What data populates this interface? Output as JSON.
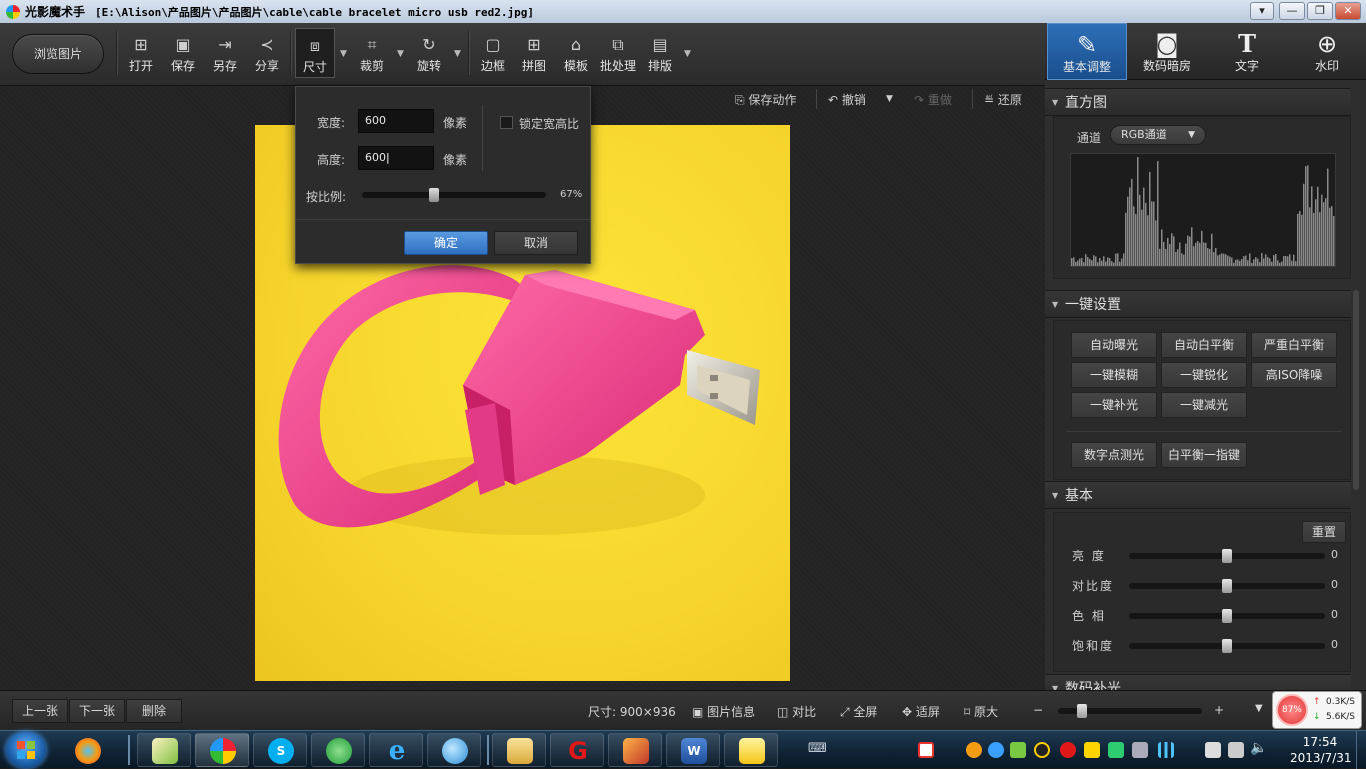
{
  "window": {
    "app_name": "光影魔术手",
    "file_path": "[E:\\Alison\\产品图片\\产品图片\\cable\\cable bracelet micro usb red2.jpg]",
    "controls": [
      "▾",
      "—",
      "❐",
      "✕"
    ]
  },
  "toolbar": {
    "browse": "浏览图片",
    "tools": [
      {
        "label": "打开",
        "icon": "open-icon"
      },
      {
        "label": "保存",
        "icon": "save-icon"
      },
      {
        "label": "另存",
        "icon": "save-as-icon"
      },
      {
        "label": "分享",
        "icon": "share-icon"
      },
      {
        "label": "尺寸",
        "icon": "resize-icon"
      },
      {
        "label": "裁剪",
        "icon": "crop-icon"
      },
      {
        "label": "旋转",
        "icon": "rotate-icon"
      },
      {
        "label": "边框",
        "icon": "border-icon"
      },
      {
        "label": "拼图",
        "icon": "collage-icon"
      },
      {
        "label": "模板",
        "icon": "template-icon"
      },
      {
        "label": "批处理",
        "icon": "batch-icon"
      },
      {
        "label": "排版",
        "icon": "layout-icon"
      }
    ]
  },
  "right_tabs": [
    {
      "label": "基本调整",
      "icon": "edit-icon"
    },
    {
      "label": "数码暗房",
      "icon": "camera-icon"
    },
    {
      "label": "文字",
      "icon": "text-icon"
    },
    {
      "label": "水印",
      "icon": "watermark-icon"
    }
  ],
  "canvas_actions": {
    "save_action": "保存动作",
    "undo": "撤销",
    "redo": "重做",
    "restore": "还原"
  },
  "resize_dialog": {
    "width_label": "宽度:",
    "width_value": "600",
    "height_label": "高度:",
    "height_value": "600",
    "unit": "像素",
    "lock_ratio": "锁定宽高比",
    "lock_checked": false,
    "scale_label": "按比例:",
    "scale_value": "67%",
    "scale_fraction": 0.67,
    "ok": "确定",
    "cancel": "取消"
  },
  "histogram": {
    "title": "直方图",
    "channel_label": "通道",
    "channel_value": "RGB通道"
  },
  "quick_settings": {
    "title": "一键设置",
    "buttons": [
      "自动曝光",
      "自动白平衡",
      "严重白平衡",
      "一键模糊",
      "一键锐化",
      "高ISO降噪",
      "一键补光",
      "一键减光"
    ],
    "buttons2": [
      "数字点测光",
      "白平衡一指键"
    ]
  },
  "basic": {
    "title": "基本",
    "reset": "重置",
    "sliders": [
      {
        "label": "亮  度",
        "value": "0"
      },
      {
        "label": "对比度",
        "value": "0"
      },
      {
        "label": "色  相",
        "value": "0"
      },
      {
        "label": "饱和度",
        "value": "0"
      }
    ],
    "next_section": "数码补光"
  },
  "bottom": {
    "prev": "上一张",
    "next": "下一张",
    "delete": "删除",
    "size": "尺寸: 900×936",
    "info": "图片信息",
    "compare": "对比",
    "fullscreen": "全屏",
    "fit": "适屏",
    "actual": "原大",
    "zoom_minus": "−",
    "zoom_plus": "+"
  },
  "net_meter": {
    "percent": "87%",
    "up": "0.3K/S",
    "down": "5.6K/S"
  },
  "taskbar": {
    "time": "17:54",
    "date": "2013/7/31"
  },
  "colors": {
    "accent_blue": "#3a78c8",
    "photo_bg": "#f6d52c",
    "bracelet_pink": "#ee3d8c"
  }
}
